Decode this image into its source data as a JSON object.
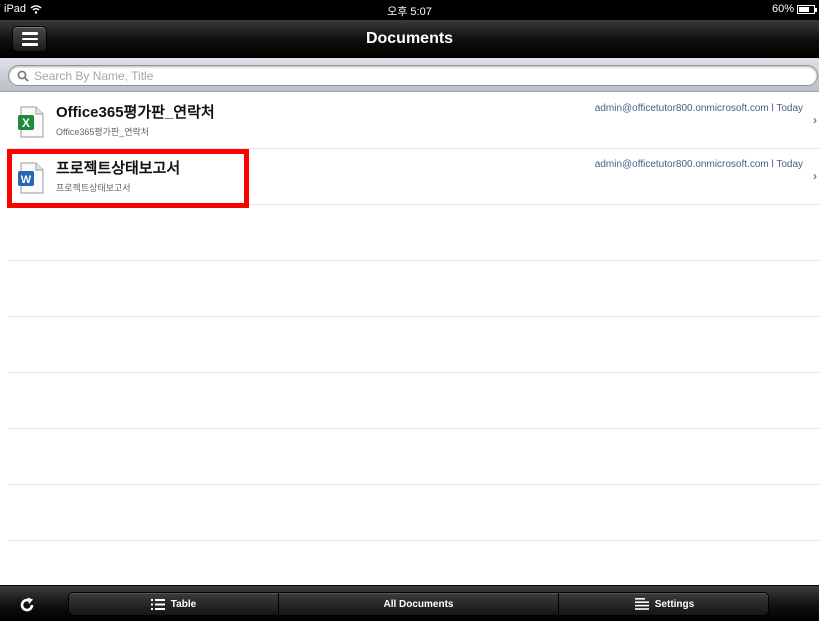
{
  "status_bar": {
    "device": "iPad",
    "time": "오후 5:07",
    "battery_percent": "60%",
    "battery_level": 0.6
  },
  "nav": {
    "title": "Documents",
    "menu_icon": "hamburger-menu-icon"
  },
  "search": {
    "placeholder": "Search By Name, Title",
    "value": ""
  },
  "documents": [
    {
      "title": "Office365평가판_연락처",
      "subtitle": "Office365평가판_연락처",
      "meta": "admin@officetutor800.onmicrosoft.com l Today",
      "icon": "excel-file-icon",
      "icon_letter": "X",
      "icon_color": "#1e8a3c"
    },
    {
      "title": "프로젝트상태보고서",
      "subtitle": "프로젝트상태보고서",
      "meta": "admin@officetutor800.onmicrosoft.com l Today",
      "icon": "word-file-icon",
      "icon_letter": "W",
      "icon_color": "#2a63b8"
    }
  ],
  "toolbar": {
    "refresh_icon": "refresh-icon",
    "table_label": "Table",
    "all_documents_label": "All Documents",
    "settings_label": "Settings"
  },
  "colors": {
    "highlight": "#ff0000",
    "meta_text": "#4a5d88"
  }
}
